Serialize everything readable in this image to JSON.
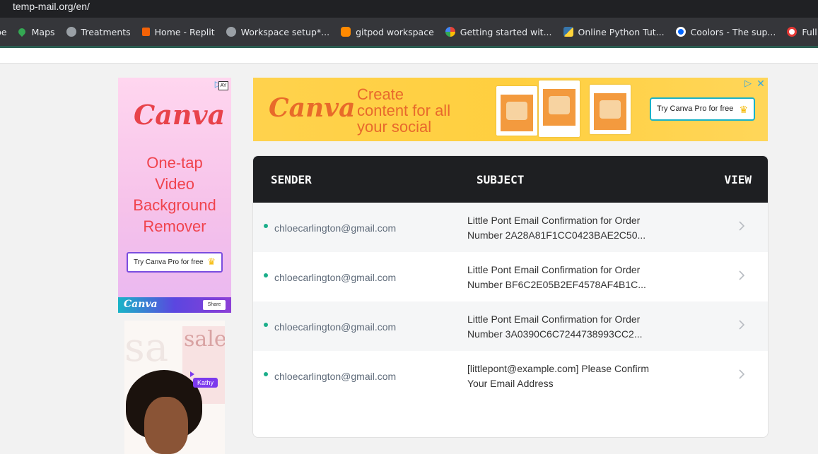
{
  "browser": {
    "url": "temp-mail.org/en/",
    "bookmarks": [
      {
        "label": "be",
        "icon": "youtube-icon",
        "color": "#35363a"
      },
      {
        "label": "Maps",
        "icon": "maps-pin-icon",
        "color": "#34a853"
      },
      {
        "label": "Treatments",
        "icon": "globe-icon",
        "color": "#9aa0a6"
      },
      {
        "label": "Home - Replit",
        "icon": "replit-icon",
        "color": "#f26207"
      },
      {
        "label": "Workspace setup*...",
        "icon": "globe-icon",
        "color": "#9aa0a6"
      },
      {
        "label": "gitpod workspace",
        "icon": "gitpod-icon",
        "color": "#ff8a00"
      },
      {
        "label": "Getting started wit...",
        "icon": "google-icon",
        "color": "#ffffff"
      },
      {
        "label": "Online Python Tut...",
        "icon": "python-icon",
        "color": "#3776ab"
      },
      {
        "label": "Coolors - The sup...",
        "icon": "coolors-icon",
        "color": "#0066ff"
      },
      {
        "label": "Full Stack De",
        "icon": "record-icon",
        "color": "#e53935"
      }
    ]
  },
  "ads": {
    "left": {
      "logo": "Canva",
      "headline_lines": [
        "One-tap",
        "Video",
        "Background",
        "Remover"
      ],
      "cta": "Try Canva Pro for free",
      "brand": "Canva",
      "share": "Share",
      "adchoices": "AY"
    },
    "left_photo": {
      "sale": "sale",
      "name_tag": "Kathy"
    },
    "top": {
      "logo": "Canva",
      "headline_lines": [
        "Create",
        "content for all",
        "your social"
      ],
      "cta": "Try Canva Pro for free"
    }
  },
  "inbox": {
    "headers": {
      "sender": "SENDER",
      "subject": "SUBJECT",
      "view": "VIEW"
    },
    "messages": [
      {
        "sender": "chloecarlington@gmail.com",
        "subject_line1": "Little Pont Email Confirmation for Order",
        "subject_line2": "Number 2A28A81F1CC0423BAE2C50..."
      },
      {
        "sender": "chloecarlington@gmail.com",
        "subject_line1": "Little Pont Email Confirmation for Order",
        "subject_line2": "Number BF6C2E05B2EF4578AF4B1C..."
      },
      {
        "sender": "chloecarlington@gmail.com",
        "subject_line1": "Little Pont Email Confirmation for Order",
        "subject_line2": "Number 3A0390C6C7244738993CC2..."
      },
      {
        "sender": "chloecarlington@gmail.com",
        "subject_line1": "[littlepont@example.com] Please Confirm",
        "subject_line2": "Your Email Address"
      }
    ]
  },
  "colors": {
    "unread_dot": "#1bae8a",
    "header_bg": "#1e1f22",
    "canva_red": "#e8434b"
  }
}
